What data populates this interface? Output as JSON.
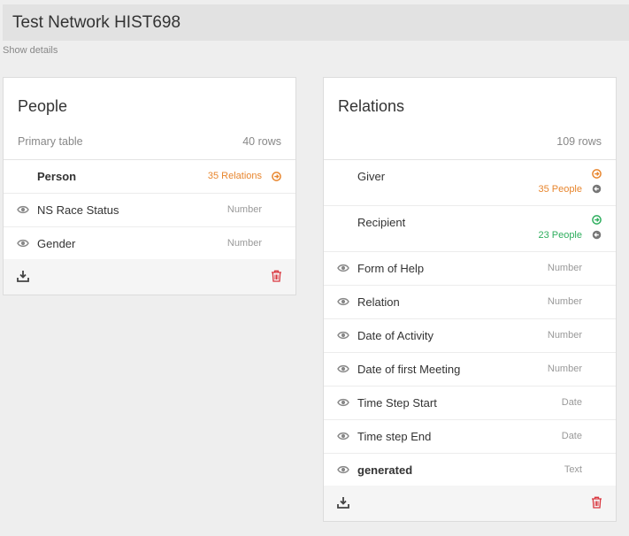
{
  "header": {
    "title": "Test Network HIST698"
  },
  "show_details": "Show details",
  "colors": {
    "orange": "#e8862e",
    "green": "#2fae5e",
    "gray": "#777777",
    "red": "#d9363e"
  },
  "people": {
    "title": "People",
    "subtitle": "Primary table",
    "rows_count": "40 rows",
    "rows": [
      {
        "label": "Person",
        "link": "35 Relations",
        "icon": "arrow-right-circle-icon"
      },
      {
        "label": "NS Race Status",
        "type": "Number",
        "icon": "eye-icon"
      },
      {
        "label": "Gender",
        "type": "Number",
        "icon": "eye-icon"
      }
    ]
  },
  "relations": {
    "title": "Relations",
    "rows_count": "109 rows",
    "rows": [
      {
        "label": "Giver",
        "count": "35 People",
        "icon": "arrow-right-circle-icon"
      },
      {
        "label": "Recipient",
        "count": "23 People",
        "icon": "arrow-right-circle-icon"
      },
      {
        "label": "Form of Help",
        "type": "Number",
        "icon": "eye-icon"
      },
      {
        "label": "Relation",
        "type": "Number",
        "icon": "eye-icon"
      },
      {
        "label": "Date of Activity",
        "type": "Number",
        "icon": "eye-icon"
      },
      {
        "label": "Date of first Meeting",
        "type": "Number",
        "icon": "eye-icon"
      },
      {
        "label": "Time Step Start",
        "type": "Date",
        "icon": "eye-icon"
      },
      {
        "label": "Time step End",
        "type": "Date",
        "icon": "eye-icon"
      },
      {
        "label": "generated",
        "type": "Text",
        "icon": "eye-icon"
      }
    ]
  }
}
